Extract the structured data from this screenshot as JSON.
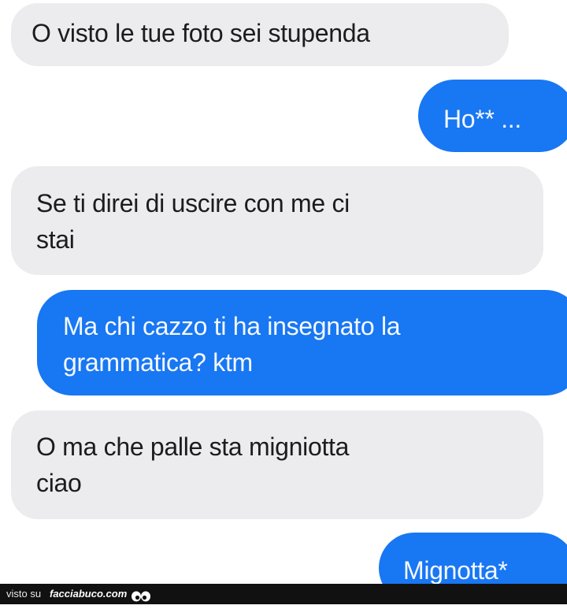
{
  "conversation": {
    "messages": [
      {
        "direction": "incoming",
        "lines": [
          "O visto le tue foto sei stupenda"
        ]
      },
      {
        "direction": "outgoing",
        "lines": [
          "Ho** ..."
        ]
      },
      {
        "direction": "incoming",
        "lines": [
          "Se ti direi di uscire con me ci",
          "stai"
        ]
      },
      {
        "direction": "outgoing",
        "lines": [
          "Ma chi cazzo ti ha insegnato la",
          "grammatica? ktm"
        ]
      },
      {
        "direction": "incoming",
        "lines": [
          "O ma che palle sta migniotta",
          "ciao"
        ]
      },
      {
        "direction": "outgoing",
        "lines": [
          "Mignotta*"
        ]
      }
    ]
  },
  "watermark": {
    "prefix": "visto su",
    "site": "facciabuco.com",
    "icon": "eyes-icon"
  },
  "colors": {
    "incoming_bubble": "#ececef",
    "incoming_text": "#1c1c1e",
    "outgoing_bubble": "#1877f2",
    "outgoing_text": "#f4f8ff",
    "page_background": "#ffffff",
    "footer_background": "#111111"
  }
}
